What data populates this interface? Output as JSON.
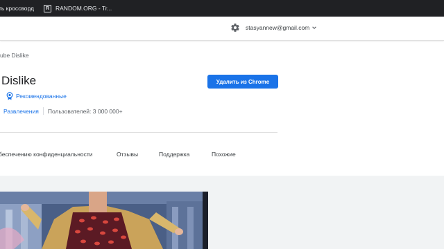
{
  "bookmarks": [
    {
      "label": "ть кроссворд"
    },
    {
      "label": "RANDOM.ORG - Tr...",
      "icon": "R"
    }
  ],
  "header": {
    "settings_icon": "gear-icon",
    "account_email": "stasyannew@gmail.com"
  },
  "breadcrumb": "ube Dislike",
  "extension": {
    "title": "Dislike",
    "remove_button": "Удалить из Chrome",
    "featured_label": "Рекомендованные",
    "category": "Развлечения",
    "users": "Пользователей: 3 000 000+"
  },
  "tabs": [
    "беспечению конфиденциальности",
    "Отзывы",
    "Поддержка",
    "Похожие"
  ],
  "colors": {
    "accent": "#1a73e8",
    "bookmarks_bar": "#202124",
    "gallery_bg": "#f1f3f4"
  }
}
